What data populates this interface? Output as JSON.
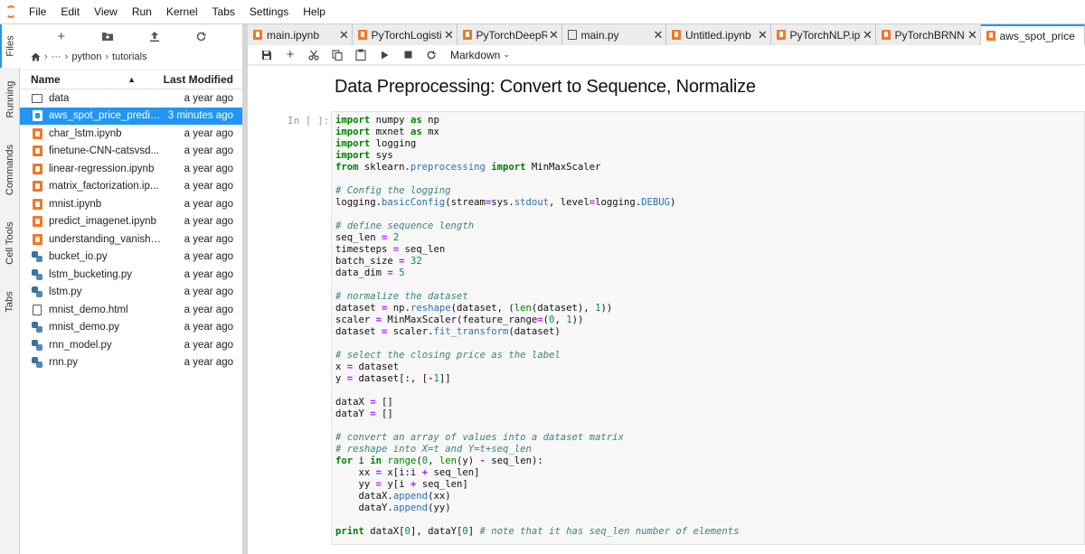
{
  "menubar": {
    "items": [
      "File",
      "Edit",
      "View",
      "Run",
      "Kernel",
      "Tabs",
      "Settings",
      "Help"
    ]
  },
  "left_tabs": [
    "Files",
    "Running",
    "Commands",
    "Cell Tools",
    "Tabs"
  ],
  "filebrowser": {
    "toolbar_icons": [
      "new-launcher-icon",
      "new-folder-icon",
      "upload-icon",
      "refresh-icon"
    ],
    "breadcrumb": {
      "ellipsis": "···",
      "parts": [
        "python",
        "tutorials"
      ]
    },
    "columns": {
      "name": "Name",
      "modified": "Last Modified"
    },
    "files": [
      {
        "name": "data",
        "type": "folder",
        "modified": "a year ago"
      },
      {
        "name": "aws_spot_price_predic...",
        "type": "notebook",
        "modified": "3 minutes ago",
        "selected": true
      },
      {
        "name": "char_lstm.ipynb",
        "type": "notebook",
        "modified": "a year ago"
      },
      {
        "name": "finetune-CNN-catsvsd...",
        "type": "notebook",
        "modified": "a year ago"
      },
      {
        "name": "linear-regression.ipynb",
        "type": "notebook",
        "modified": "a year ago"
      },
      {
        "name": "matrix_factorization.ip...",
        "type": "notebook",
        "modified": "a year ago"
      },
      {
        "name": "mnist.ipynb",
        "type": "notebook",
        "modified": "a year ago"
      },
      {
        "name": "predict_imagenet.ipynb",
        "type": "notebook",
        "modified": "a year ago"
      },
      {
        "name": "understanding_vanish_...",
        "type": "notebook",
        "modified": "a year ago"
      },
      {
        "name": "bucket_io.py",
        "type": "python",
        "modified": "a year ago"
      },
      {
        "name": "lstm_bucketing.py",
        "type": "python",
        "modified": "a year ago"
      },
      {
        "name": "lstm.py",
        "type": "python",
        "modified": "a year ago"
      },
      {
        "name": "mnist_demo.html",
        "type": "html",
        "modified": "a year ago"
      },
      {
        "name": "mnist_demo.py",
        "type": "python",
        "modified": "a year ago"
      },
      {
        "name": "rnn_model.py",
        "type": "python",
        "modified": "a year ago"
      },
      {
        "name": "rnn.py",
        "type": "python",
        "modified": "a year ago"
      }
    ]
  },
  "tabs": [
    {
      "label": "main.ipynb",
      "type": "notebook"
    },
    {
      "label": "PyTorchLogistic",
      "type": "notebook"
    },
    {
      "label": "PyTorchDeepRe",
      "type": "notebook"
    },
    {
      "label": "main.py",
      "type": "file"
    },
    {
      "label": "Untitled.ipynb",
      "type": "notebook"
    },
    {
      "label": "PyTorchNLP.ipy",
      "type": "notebook"
    },
    {
      "label": "PyTorchBRNN.i",
      "type": "notebook"
    },
    {
      "label": "aws_spot_price",
      "type": "notebook",
      "active": true
    }
  ],
  "notebook": {
    "toolbar_icons": [
      "save-icon",
      "add-cell-icon",
      "cut-icon",
      "copy-icon",
      "paste-icon",
      "run-icon",
      "stop-icon",
      "restart-icon"
    ],
    "cell_type": "Markdown",
    "heading": "Data Preprocessing: Convert to Sequence, Normalize",
    "prompt": "In [ ]:",
    "code_lines": [
      "import numpy as np",
      "import mxnet as mx",
      "import logging",
      "import sys",
      "from sklearn.preprocessing import MinMaxScaler",
      "",
      "# Config the logging",
      "logging.basicConfig(stream=sys.stdout, level=logging.DEBUG)",
      "",
      "# define sequence length",
      "seq_len = 2",
      "timesteps = seq_len",
      "batch_size = 32",
      "data_dim = 5",
      "",
      "# normalize the dataset",
      "dataset = np.reshape(dataset, (len(dataset), 1))",
      "scaler = MinMaxScaler(feature_range=(0, 1))",
      "dataset = scaler.fit_transform(dataset)",
      "",
      "# select the closing price as the label",
      "x = dataset",
      "y = dataset[:, [-1]]",
      "",
      "dataX = []",
      "dataY = []",
      "",
      "# convert an array of values into a dataset matrix",
      "# reshape into X=t and Y=t+seq_len",
      "for i in range(0, len(y) - seq_len):",
      "    xx = x[i:i + seq_len]",
      "    yy = y[i + seq_len]",
      "    dataX.append(xx)",
      "    dataY.append(yy)",
      "",
      "print dataX[0], dataY[0] # note that it has seq_len number of elements"
    ]
  }
}
